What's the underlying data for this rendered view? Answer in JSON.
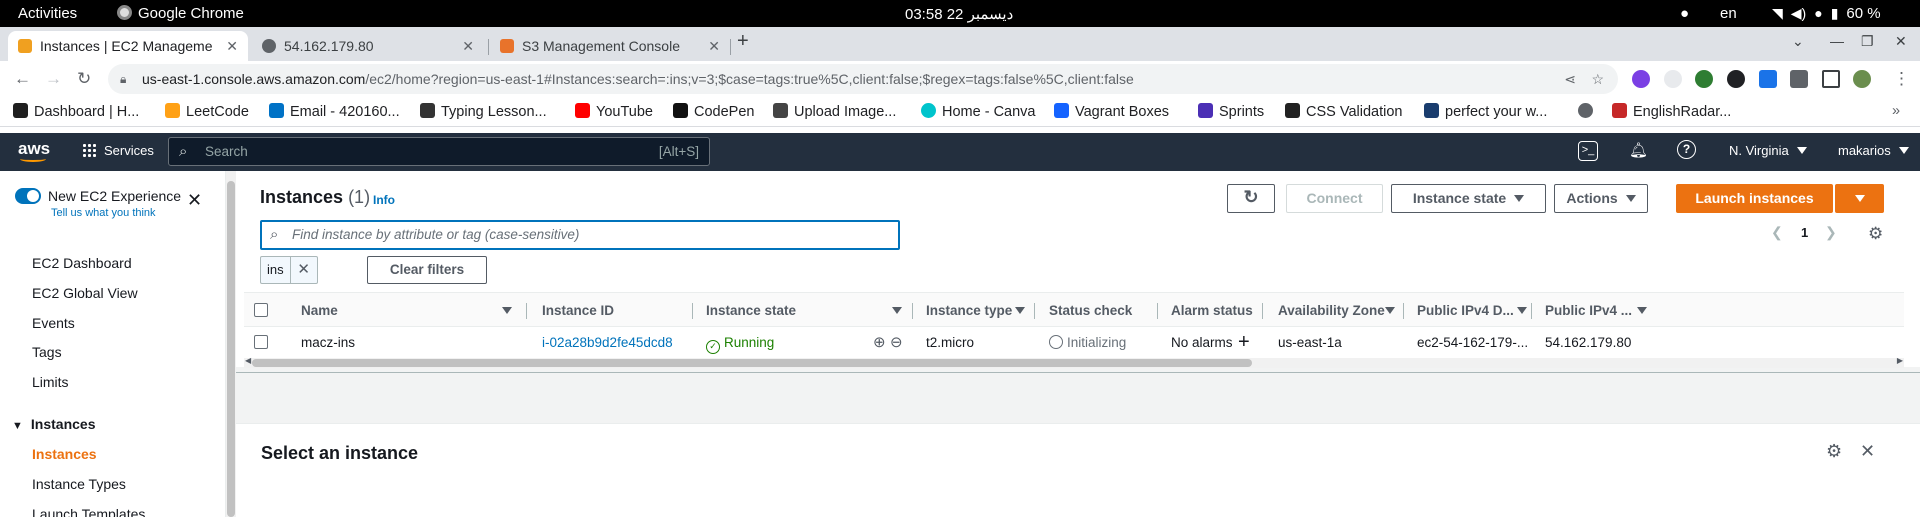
{
  "os": {
    "activities": "Activities",
    "app_name": "Google Chrome",
    "clock": "03:58  22 ديسمبر",
    "lang": "en",
    "battery": "60 %"
  },
  "browser": {
    "tabs": [
      {
        "label": "Instances | EC2 Manageme",
        "favicon_color": "#f0a020"
      },
      {
        "label": "54.162.179.80",
        "favicon_color": "#5f6368"
      },
      {
        "label": "S3 Management Console",
        "favicon_color": "#e8732b"
      }
    ],
    "url_host": "us-east-1.console.aws.amazon.com",
    "url_path": "/ec2/home?region=us-east-1#Instances:search=:ins;v=3;$case=tags:true%5C,client:false;$regex=tags:false%5C,client:false",
    "bookmarks": [
      {
        "label": "Dashboard | H...",
        "icon_color": "#1f1f1f"
      },
      {
        "label": "LeetCode",
        "icon_color": "#ffa116"
      },
      {
        "label": "Email - 420160...",
        "icon_color": "#0072c6"
      },
      {
        "label": "Typing Lesson...",
        "icon_color": "#333333"
      },
      {
        "label": "YouTube",
        "icon_color": "#ff0000"
      },
      {
        "label": "CodePen",
        "icon_color": "#111111"
      },
      {
        "label": "Upload Image...",
        "icon_color": "#444444"
      },
      {
        "label": "Home - Canva",
        "icon_color": "#00c4cc"
      },
      {
        "label": "Vagrant Boxes",
        "icon_color": "#1563ff"
      },
      {
        "label": "Sprints",
        "icon_color": "#4b2fb5"
      },
      {
        "label": "CSS Validation",
        "icon_color": "#222222"
      },
      {
        "label": "perfect your w...",
        "icon_color": "#1a3d6e"
      },
      {
        "label": "",
        "icon_color": "#5f6368"
      },
      {
        "label": "EnglishRadar...",
        "icon_color": "#c62828"
      }
    ]
  },
  "aws": {
    "logo": "aws",
    "services_label": "Services",
    "search_placeholder": "Search",
    "search_shortcut": "[Alt+S]",
    "region": "N. Virginia",
    "user": "makarios"
  },
  "sidebar": {
    "toggle_label": "New EC2 Experience",
    "feedback_link": "Tell us what you think",
    "items": [
      "EC2 Dashboard",
      "EC2 Global View",
      "Events",
      "Tags",
      "Limits"
    ],
    "section": "Instances",
    "section_items": [
      "Instances",
      "Instance Types",
      "Launch Templates"
    ]
  },
  "instances": {
    "title": "Instances",
    "count": "(1)",
    "info": "Info",
    "connect": "Connect",
    "instance_state": "Instance state",
    "actions": "Actions",
    "launch": "Launch instances",
    "filter_placeholder": "Find instance by attribute or tag (case-sensitive)",
    "page": "1",
    "chip": "ins",
    "clear_filters": "Clear filters",
    "columns": [
      "Name",
      "Instance ID",
      "Instance state",
      "Instance type",
      "Status check",
      "Alarm status",
      "Availability Zone",
      "Public IPv4 D...",
      "Public IPv4 ..."
    ],
    "row": {
      "name": "macz-ins",
      "id": "i-02a28b9d2fe45dcd8",
      "state": "Running",
      "type": "t2.micro",
      "status": "Initializing",
      "alarm": "No alarms",
      "az": "us-east-1a",
      "dns": "ec2-54-162-179-...",
      "ip": "54.162.179.80"
    }
  },
  "detail": {
    "title": "Select an instance"
  },
  "colors": {
    "aws_orange": "#ec7211",
    "aws_nav": "#232f3e",
    "link_blue": "#0073bb",
    "running_green": "#1d8102"
  }
}
